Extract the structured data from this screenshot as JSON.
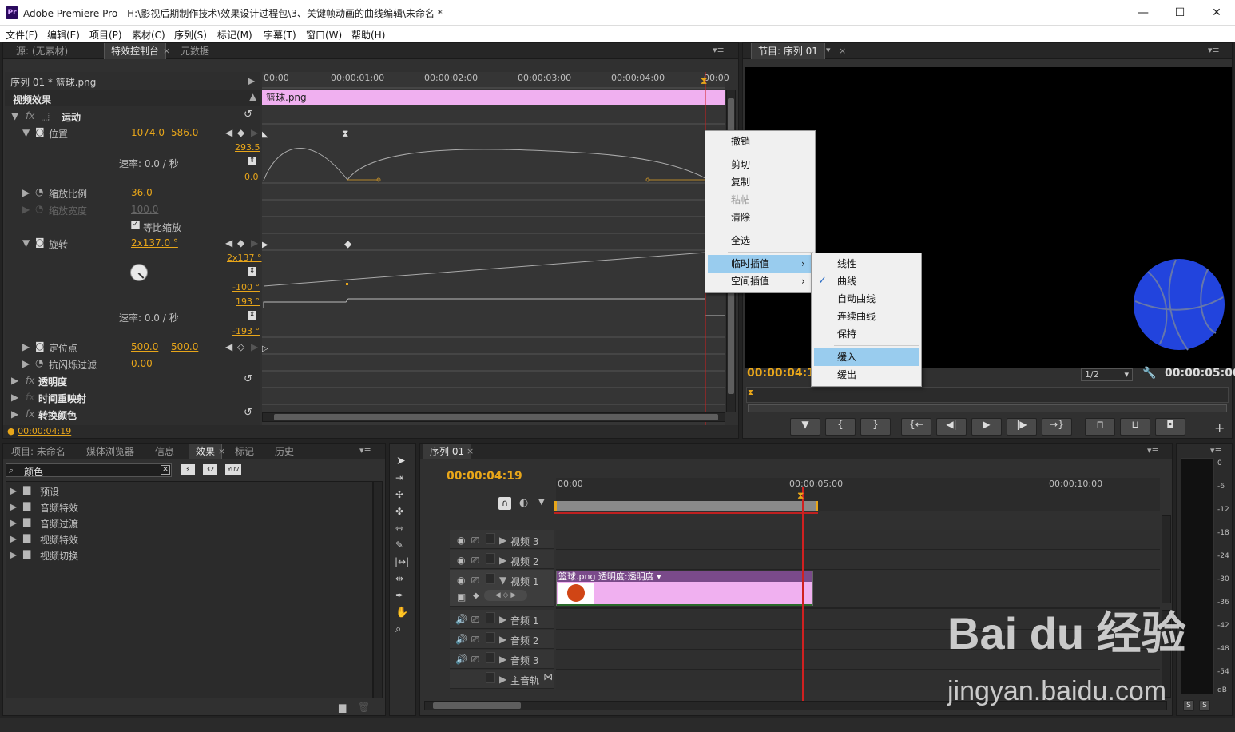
{
  "window": {
    "app": "Pr",
    "title": "Adobe Premiere Pro - H:\\影视后期制作技术\\效果设计过程包\\3、关键帧动画的曲线编辑\\未命名 *",
    "controls": [
      "—",
      "☐",
      "✕"
    ]
  },
  "menubar": [
    "文件(F)",
    "编辑(E)",
    "项目(P)",
    "素材(C)",
    "序列(S)",
    "标记(M)",
    "字幕(T)",
    "窗口(W)",
    "帮助(H)"
  ],
  "effect_controls": {
    "tabs": [
      "源: (无素材)",
      "特效控制台",
      "元数据"
    ],
    "active_tab": "特效控制台",
    "clip_header": "序列 01 * 篮球.png",
    "ruler": [
      "00:00",
      "00:00:01:00",
      "00:00:02:00",
      "00:00:03:00",
      "00:00:04:00",
      "00:00"
    ],
    "clip_bar": "篮球.png",
    "section": "视频效果",
    "motion_label": "运动",
    "position": {
      "label": "位置",
      "x": "1074.0",
      "y": "586.0"
    },
    "pos_graph": {
      "top": "293.5",
      "bottom": "0.0",
      "speed": "速率: 0.0 / 秒"
    },
    "scale": {
      "label": "缩放比例",
      "value": "36.0"
    },
    "scale_width": {
      "label": "缩放宽度",
      "value": "100.0"
    },
    "uniform": "等比缩放",
    "rotation": {
      "label": "旋转",
      "value": "2x137.0 °"
    },
    "rot_graph": {
      "top": "2x137 °",
      "mid": "-100 °",
      "vtop": "193 °",
      "vbottom": "-193 °",
      "speed": "速率: 0.0 / 秒"
    },
    "anchor": {
      "label": "定位点",
      "x": "500.0",
      "y": "500.0"
    },
    "anti_flicker": {
      "label": "抗闪烁过滤",
      "value": "0.00"
    },
    "opacity": "透明度",
    "time_remap": "时间重映射",
    "color_effect": "转换颜色",
    "timecode": "00:00:04:19"
  },
  "context_menu": {
    "items": [
      "撤销",
      "剪切",
      "复制",
      "粘帖",
      "清除",
      "全选",
      "临时插值",
      "空间插值"
    ],
    "disabled": "粘帖",
    "highlighted": "临时插值"
  },
  "submenu": {
    "items": [
      "线性",
      "曲线",
      "自动曲线",
      "连续曲线",
      "保持",
      "缓入",
      "缓出"
    ],
    "checked": "曲线",
    "highlighted": "缓入"
  },
  "program_monitor": {
    "tab": "节目: 序列 01",
    "timecode_left": "00:00:04:19",
    "resolution": "1/2",
    "timecode_right": "00:00:05:00",
    "ball_color": "#2244dd"
  },
  "project_panel": {
    "tabs": [
      "项目: 未命名",
      "媒体浏览器",
      "信息",
      "效果",
      "标记",
      "历史"
    ],
    "active_tab": "效果",
    "search": "颜色",
    "badges": [
      "32",
      "YUV"
    ],
    "folders": [
      "预设",
      "音频特效",
      "音频过渡",
      "视频特效",
      "视频切换"
    ]
  },
  "timeline": {
    "tab": "序列 01",
    "timecode": "00:00:04:19",
    "ruler": [
      "00:00",
      "00:00:05:00",
      "00:00:10:00"
    ],
    "video_tracks": [
      "视频 3",
      "视频 2",
      "视频 1"
    ],
    "audio_tracks": [
      "音频 1",
      "音频 2",
      "音频 3"
    ],
    "master": "主音轨",
    "clip_label": "篮球.png 透明度:透明度"
  },
  "meter": {
    "scale": [
      "0",
      "-6",
      "-12",
      "-18",
      "-24",
      "-30",
      "-36",
      "-42",
      "-48",
      "-54",
      "dB"
    ],
    "solo": [
      "S",
      "S"
    ]
  },
  "watermark": {
    "brand": "Bai du 经验",
    "url": "jingyan.baidu.com"
  }
}
